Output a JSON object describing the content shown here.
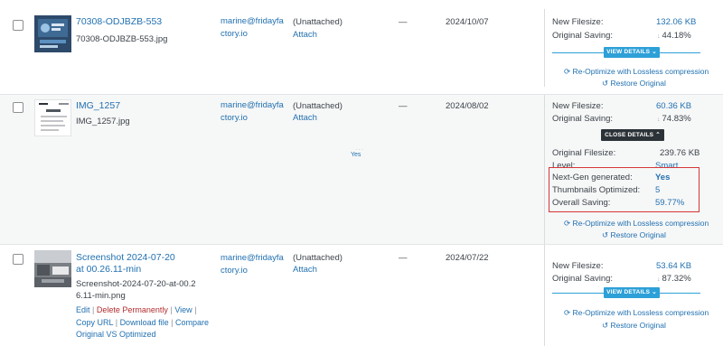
{
  "rows": [
    {
      "title": "70308-ODJBZB-553",
      "filename": "70308-ODJBZB-553.jpg",
      "author": "marine@fridayfactory.io",
      "attached": "(Unattached)",
      "attach_link": "Attach",
      "dash": "—",
      "date": "2024/10/07",
      "stats": {
        "new_filesize_label": "New Filesize:",
        "new_filesize_value": "132.06 KB",
        "original_saving_label": "Original Saving:",
        "original_saving_value": "44.18%"
      },
      "details_button": "VIEW DETAILS",
      "reoptimize": "Re-Optimize with Lossless compression",
      "restore": "Restore Original"
    },
    {
      "title": "IMG_1257",
      "filename": "IMG_1257.jpg",
      "author": "marine@fridayfactory.io",
      "attached": "(Unattached)",
      "attach_link": "Attach",
      "dash": "—",
      "date": "2024/08/02",
      "middle_value": "Yes",
      "stats": {
        "new_filesize_label": "New Filesize:",
        "new_filesize_value": "60.36 KB",
        "original_saving_label": "Original Saving:",
        "original_saving_value": "74.83%"
      },
      "details_button": "CLOSE DETAILS",
      "details": {
        "original_filesize_label": "Original Filesize:",
        "original_filesize_value": "239.76 KB",
        "level_label": "Level:",
        "level_value": "Smart",
        "nextgen_label": "Next-Gen generated:",
        "nextgen_value": "Yes",
        "thumbnails_label": "Thumbnails Optimized:",
        "thumbnails_value": "5",
        "overall_label": "Overall Saving:",
        "overall_value": "59.77%"
      },
      "reoptimize": "Re-Optimize with Lossless compression",
      "restore": "Restore Original"
    },
    {
      "title": "Screenshot 2024-07-20 at 00.26.11-min",
      "filename": "Screenshot-2024-07-20-at-00.26.11-min.png",
      "author": "marine@fridayfactory.io",
      "attached": "(Unattached)",
      "attach_link": "Attach",
      "dash": "—",
      "date": "2024/07/22",
      "actions": {
        "edit": "Edit",
        "delete": "Delete Permanently",
        "view": "View",
        "copy_url": "Copy URL",
        "download": "Download file",
        "compare": "Compare",
        "compare2": "Original VS Optimized"
      },
      "stats": {
        "new_filesize_label": "New Filesize:",
        "new_filesize_value": "53.64 KB",
        "original_saving_label": "Original Saving:",
        "original_saving_value": "87.32%"
      },
      "details_button": "VIEW DETAILS",
      "reoptimize": "Re-Optimize with Lossless compression",
      "restore": "Restore Original"
    }
  ],
  "colors": {
    "link": "#2271b1",
    "button_blue": "#2da0d8",
    "button_dark": "#2c3338",
    "highlight_border": "#d63638",
    "delete": "#b32d2e"
  }
}
